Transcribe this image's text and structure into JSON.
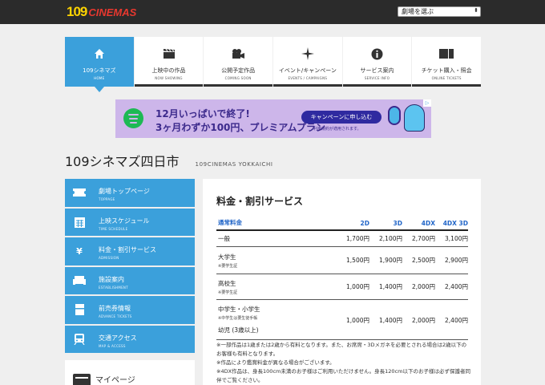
{
  "header": {
    "logo_num": "109",
    "logo_word": "CINEMAS",
    "theater_select": "劇場を選ぶ"
  },
  "nav": [
    {
      "jp": "109シネマズ",
      "en": "HOME",
      "icon": "home-icon",
      "active": true
    },
    {
      "jp": "上映中の作品",
      "en": "NOW SHOWING",
      "icon": "clapperboard-icon"
    },
    {
      "jp": "公開予定作品",
      "en": "COMING SOON",
      "icon": "camera-icon"
    },
    {
      "jp": "イベント/キャンペーン",
      "en": "EVENTS / CAMPAIGNS",
      "icon": "sparkle-icon"
    },
    {
      "jp": "サービス案内",
      "en": "SERVICE INFO",
      "icon": "info-icon"
    },
    {
      "jp": "チケット購入・照会",
      "en": "ONLINE TICKETS",
      "icon": "ticket-icon"
    }
  ],
  "banner": {
    "line1": "12月いっぱいで終了!",
    "line2": "3ヶ月わずか100円、プレミアムプラン",
    "cta": "キャンペーンに申し込む",
    "note": "利用規約が適用されます。",
    "ad_mark": "▷"
  },
  "page": {
    "title": "109シネマズ四日市",
    "title_en": "109CINEMAS YOKKAICHI"
  },
  "sidebar": [
    {
      "jp": "劇場トップページ",
      "en": "TOPPAGE",
      "icon": "ticket-stub-icon"
    },
    {
      "jp": "上映スケジュール",
      "en": "TIME SCHEDULE",
      "icon": "calendar-icon"
    },
    {
      "jp": "料金・割引サービス",
      "en": "ADMISSION",
      "icon": "yen-icon"
    },
    {
      "jp": "施設案内",
      "en": "ESTABLISHMENT",
      "icon": "sofa-icon"
    },
    {
      "jp": "前売券情報",
      "en": "ADVANCE TICKETS",
      "icon": "document-icon"
    },
    {
      "jp": "交通アクセス",
      "en": "MAP & ACCESS",
      "icon": "train-icon"
    }
  ],
  "mypage": {
    "label": "マイページ"
  },
  "pricing": {
    "section_title": "料金・割引サービス",
    "headers": [
      "通常料金",
      "2D",
      "3D",
      "4DX",
      "4DX 3D"
    ],
    "rows": [
      {
        "name": "一般",
        "sub": "",
        "values": [
          "1,700円",
          "2,100円",
          "2,700円",
          "3,100円"
        ]
      },
      {
        "name": "大学生",
        "sub": "※要学生証",
        "values": [
          "1,500円",
          "1,900円",
          "2,500円",
          "2,900円"
        ]
      },
      {
        "name": "高校生",
        "sub": "※要学生証",
        "values": [
          "1,000円",
          "1,400円",
          "2,000円",
          "2,400円"
        ]
      },
      {
        "name": "中学生・小学生",
        "sub": "※中学生は要生徒手帳",
        "values": [
          "1,000円",
          "1,400円",
          "2,000円",
          "2,400円"
        ],
        "extra": "幼児 (3歳以上)"
      }
    ],
    "notes": [
      "※一部作品は1歳または2歳から有料となります。また、お席席・3Dメガネを必要とされる場合は2歳以下のお客様も有料となります。",
      "※作品により鑑賞料金が異なる場合がございます。",
      "※4DX作品は、身長100cm未満のお子様はご利用いただけません。身長120cm以下のお子様は必ず保護者同伴でご覧ください。"
    ]
  },
  "colors": {
    "accent": "#3ba0db",
    "topbar": "#2b2b2b",
    "link_blue": "#2266c8"
  }
}
